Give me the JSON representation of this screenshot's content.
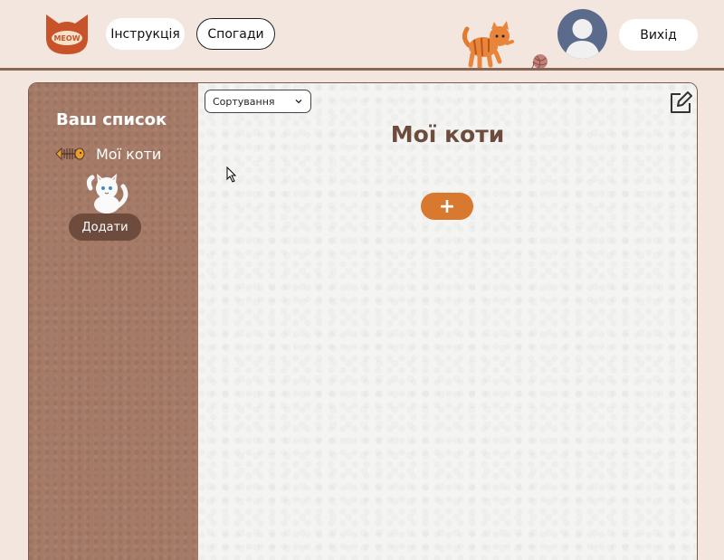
{
  "header": {
    "logo_text": "MEOW",
    "nav": [
      {
        "label": "Інструкція"
      },
      {
        "label": "Спогади"
      }
    ],
    "exit_label": "Вихід"
  },
  "sidebar": {
    "title": "Ваш список",
    "items": [
      {
        "label": "Мої коти",
        "icon": "fish-bone-icon"
      }
    ],
    "add_label": "Додати"
  },
  "main": {
    "sort": {
      "selected": "Сортування"
    },
    "title": "Мої коти",
    "add_symbol": "+"
  },
  "colors": {
    "background": "#f2e6df",
    "sidebar": "#a57a67",
    "accent_orange": "#d9782f",
    "brown_dark": "#6e4c3d"
  }
}
